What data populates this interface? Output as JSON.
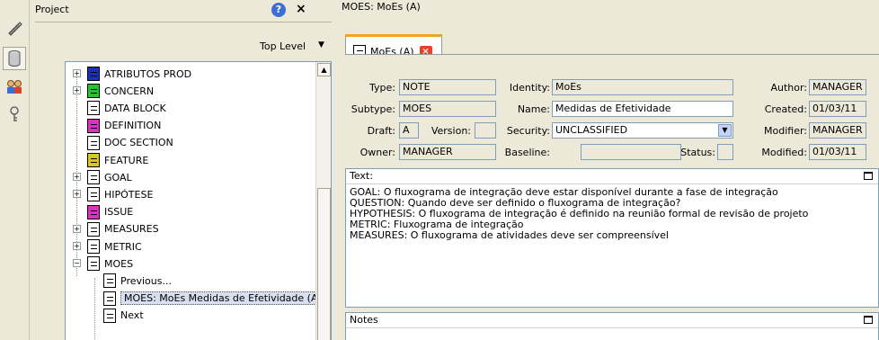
{
  "toolstrip": {
    "icons": [
      "pen-icon",
      "cylinder-icon",
      "users-icon",
      "key-icon"
    ]
  },
  "project": {
    "title": "Project",
    "help": "?",
    "close": "×",
    "level": "Top Level",
    "tree": [
      {
        "label": "ATRIBUTOS PROD",
        "color": "#1a2fbf",
        "expandable": true,
        "indent": 0
      },
      {
        "label": "CONCERN",
        "color": "#2fbf2f",
        "expandable": true,
        "indent": 0
      },
      {
        "label": "DATA BLOCK",
        "color": "#ffffff",
        "expandable": false,
        "indent": 0
      },
      {
        "label": "DEFINITION",
        "color": "#e030c0",
        "expandable": false,
        "indent": 0
      },
      {
        "label": "DOC SECTION",
        "color": "#ffffff",
        "expandable": false,
        "indent": 0
      },
      {
        "label": "FEATURE",
        "color": "#d8c820",
        "expandable": false,
        "indent": 0
      },
      {
        "label": "GOAL",
        "color": "#ffffff",
        "expandable": true,
        "indent": 0
      },
      {
        "label": "HIPÓTESE",
        "color": "#ffffff",
        "expandable": true,
        "indent": 0
      },
      {
        "label": "ISSUE",
        "color": "#e030c0",
        "expandable": false,
        "indent": 0
      },
      {
        "label": "MEASURES",
        "color": "#ffffff",
        "expandable": true,
        "indent": 0
      },
      {
        "label": "METRIC",
        "color": "#ffffff",
        "expandable": true,
        "indent": 0
      },
      {
        "label": "MOES",
        "color": "#ffffff",
        "expandable": true,
        "expanded": true,
        "indent": 0
      },
      {
        "label": "Previous...",
        "color": "#ffffff",
        "expandable": false,
        "indent": 1
      },
      {
        "label": "MOES: MoEs  Medidas de Efetividade (A)",
        "color": "#ffffff",
        "expandable": false,
        "indent": 1,
        "selected": true
      },
      {
        "label": "Next",
        "color": "#ffffff",
        "expandable": false,
        "indent": 1
      }
    ]
  },
  "editor": {
    "title": "MOES: MoEs (A)",
    "tab_label": "MoEs (A)",
    "tab_close": "×",
    "fields": {
      "type_label": "Type:",
      "type": "NOTE",
      "subtype_label": "Subtype:",
      "subtype": "MOES",
      "draft_label": "Draft:",
      "draft": "A",
      "version_label": "Version:",
      "version": "",
      "owner_label": "Owner:",
      "owner": "MANAGER",
      "identity_label": "Identity:",
      "identity": "MoEs",
      "name_label": "Name:",
      "name": "Medidas de Efetividade",
      "security_label": "Security:",
      "security": "UNCLASSIFIED",
      "baseline_label": "Baseline:",
      "baseline": "",
      "status_label": "Status:",
      "status": "",
      "author_label": "Author:",
      "author": "MANAGER",
      "created_label": "Created:",
      "created": "01/03/11",
      "modifier_label": "Modifier:",
      "modifier": "MANAGER",
      "modified_label": "Modified:",
      "modified": "01/03/11"
    },
    "text_label": "Text:",
    "text_lines": [
      "GOAL: O fluxograma de integração deve estar disponível durante a fase de integração",
      "QUESTION: Quando deve ser definido o fluxograma de integração?",
      "HYPOTHESIS: O fluxograma de integração é definido na reunião formal de revisão de projeto",
      "METRIC: Fluxograma de integração",
      "MEASURES: O fluxograma de atividades deve ser compreensível"
    ],
    "notes_label": "Notes"
  }
}
